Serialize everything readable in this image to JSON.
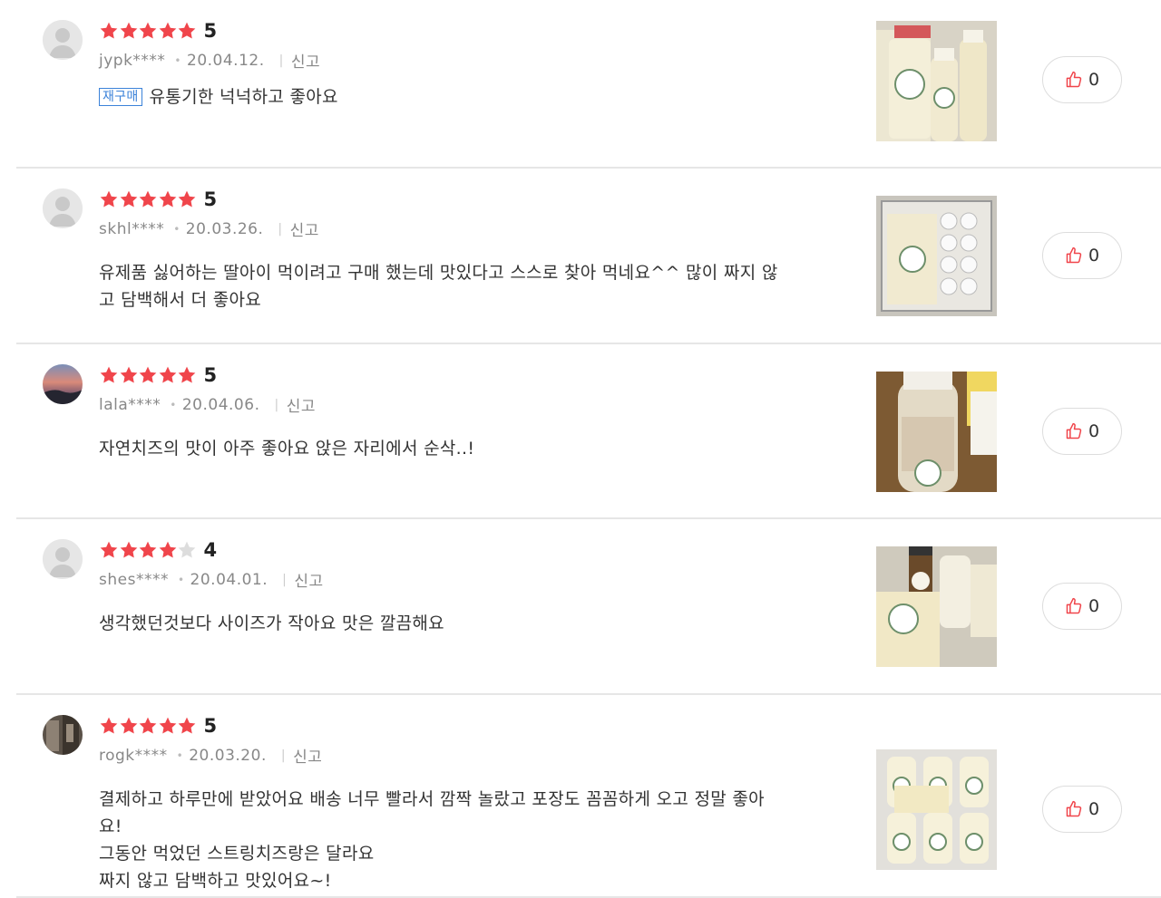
{
  "reviews": [
    {
      "rating": 5,
      "score_label": "5",
      "user": "jypk****",
      "date": "20.04.12.",
      "report_label": "신고",
      "badge": "재구매",
      "lines": [
        "유통기한 넉넉하고 좋아요"
      ],
      "likes": "0",
      "avatar": "default"
    },
    {
      "rating": 5,
      "score_label": "5",
      "user": "skhl****",
      "date": "20.03.26.",
      "report_label": "신고",
      "badge": "",
      "lines": [
        "유제품 싫어하는 딸아이 먹이려고 구매 했는데 맛있다고 스스로 찾아 먹네요^^ 많이 짜지 않",
        "고 담백해서 더 좋아요"
      ],
      "likes": "0",
      "avatar": "default"
    },
    {
      "rating": 5,
      "score_label": "5",
      "user": "lala****",
      "date": "20.04.06.",
      "report_label": "신고",
      "badge": "",
      "lines": [
        "자연치즈의 맛이 아주 좋아요 앉은 자리에서 순삭..!"
      ],
      "likes": "0",
      "avatar": "sunset"
    },
    {
      "rating": 4,
      "score_label": "4",
      "user": "shes****",
      "date": "20.04.01.",
      "report_label": "신고",
      "badge": "",
      "lines": [
        "생각했던것보다 사이즈가 작아요 맛은 깔끔해요"
      ],
      "likes": "0",
      "avatar": "default"
    },
    {
      "rating": 5,
      "score_label": "5",
      "user": "rogk****",
      "date": "20.03.20.",
      "report_label": "신고",
      "badge": "",
      "lines": [
        "결제하고 하루만에 받았어요 배송 너무 빨라서 깜짝 놀랐고 포장도 꼼꼼하게 오고 정말 좋아",
        "요!",
        "그동안 먹었던 스트링치즈랑은 달라요",
        "짜지 않고 담백하고 맛있어요~!"
      ],
      "likes": "0",
      "avatar": "dark"
    }
  ],
  "colors": {
    "star_on": "#f0454b",
    "star_off": "#dddddd",
    "badge": "#3b82d9",
    "like_icon": "#f0454b"
  },
  "icons": {
    "star": "star-icon",
    "like": "thumbs-up-icon"
  }
}
